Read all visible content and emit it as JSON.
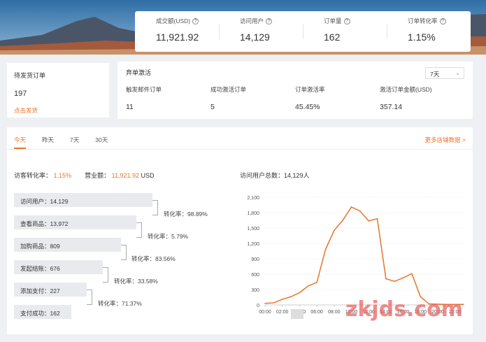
{
  "stats": [
    {
      "label": "成交额(USD)",
      "value": "11,921.92"
    },
    {
      "label": "访问用户",
      "value": "14,129"
    },
    {
      "label": "订单量",
      "value": "162"
    },
    {
      "label": "订单转化率",
      "value": "1.15%"
    }
  ],
  "pending": {
    "title": "待发货订单",
    "count": "197",
    "link": "点击发货"
  },
  "abandon": {
    "title": "弃单激活",
    "range": "7天",
    "metrics": [
      {
        "label": "触发邮件订单",
        "value": "11"
      },
      {
        "label": "成功激活订单",
        "value": "5"
      },
      {
        "label": "订单激活率",
        "value": "45.45%"
      },
      {
        "label": "激活订单金额(USD)",
        "value": "357.14"
      }
    ]
  },
  "tabs": [
    "今天",
    "昨天",
    "7天",
    "30天"
  ],
  "more_link": "更多店铺数据 >",
  "summary": {
    "conv_label": "访客转化率：",
    "conv_value": "1.15%",
    "sales_label": "营业额：",
    "sales_value": "11,921.92",
    "sales_unit": "USD"
  },
  "funnel": {
    "steps": [
      {
        "label": "访问用户：14,129"
      },
      {
        "label": "查看商品：13,972"
      },
      {
        "label": "加购商品：809"
      },
      {
        "label": "发起结账：676"
      },
      {
        "label": "添加支付：227"
      },
      {
        "label": "支付成功：162"
      }
    ],
    "conversions": [
      "转化率：98.89%",
      "转化率：5.79%",
      "转化率：83.56%",
      "转化率：33.58%",
      "转化率：71.37%"
    ]
  },
  "chart_title": "访问用户总数：14,129人",
  "chart_data": {
    "type": "line",
    "title": "访问用户总数：14,129人",
    "x": [
      "00:00",
      "01:00",
      "02:00",
      "03:00",
      "04:00",
      "05:00",
      "06:00",
      "07:00",
      "08:00",
      "09:00",
      "10:00",
      "11:00",
      "12:00",
      "13:00",
      "14:00",
      "15:00",
      "16:00",
      "17:00",
      "18:00",
      "19:00",
      "20:00",
      "21:00",
      "22:00",
      "23:00"
    ],
    "xticks": [
      "00:00",
      "02:00",
      "04:00",
      "06:00",
      "08:00",
      "10:00",
      "12:00",
      "14:00",
      "16:00",
      "18:00",
      "20:00",
      "22:00"
    ],
    "values": [
      30,
      40,
      110,
      160,
      240,
      370,
      440,
      1080,
      1450,
      1650,
      1910,
      1830,
      1640,
      1680,
      510,
      460,
      530,
      610,
      160,
      20,
      15,
      10,
      10,
      10
    ],
    "ylim": [
      0,
      2100
    ],
    "yticks": [
      "0",
      "300",
      "600",
      "900",
      "1,200",
      "1,500",
      "1,800",
      "2,100"
    ],
    "color": "#e8742c",
    "grid": true
  },
  "watermark": "zkjds.com"
}
